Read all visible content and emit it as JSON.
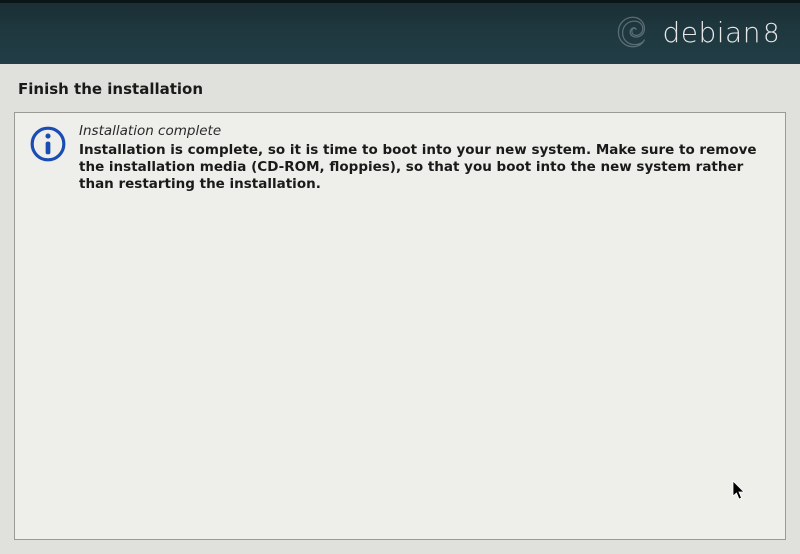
{
  "header": {
    "brand": "debian",
    "version": "8"
  },
  "page": {
    "title": "Finish the installation"
  },
  "panel": {
    "section_title": "Installation complete",
    "section_body": "Installation is complete, so it is time to boot into your new system. Make sure to remove the installation media (CD-ROM, floppies), so that you boot into the new system rather than restarting the installation."
  }
}
